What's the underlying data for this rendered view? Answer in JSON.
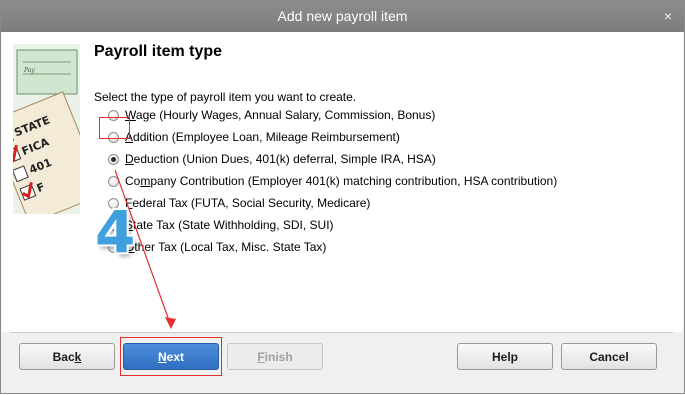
{
  "window": {
    "title": "Add new payroll item",
    "close_glyph": "×"
  },
  "heading": "Payroll item type",
  "prompt": "Select the type of payroll item you want to create.",
  "options": [
    {
      "mnemonic": "W",
      "rest": "age (Hourly Wages, Annual Salary, Commission, Bonus)",
      "checked": false
    },
    {
      "mnemonic": "A",
      "rest": "ddition (Employee Loan, Mileage Reimbursement)",
      "checked": false
    },
    {
      "mnemonic": "D",
      "rest": "eduction (Union Dues, 401(k) deferral, Simple IRA, HSA)",
      "checked": true
    },
    {
      "pre": "Co",
      "mnemonic": "m",
      "rest": "pany Contribution (Employer 401(k) matching contribution, HSA contribution)",
      "checked": false
    },
    {
      "mnemonic": "F",
      "rest": "ederal Tax (FUTA, Social Security, Medicare)",
      "checked": false
    },
    {
      "mnemonic": "S",
      "rest": "tate Tax (State Withholding, SDI, SUI)",
      "checked": false
    },
    {
      "mnemonic": "O",
      "rest": "ther Tax (Local Tax, Misc. State Tax)",
      "checked": false
    }
  ],
  "annotation": {
    "step_number": "4",
    "color": "#e53030",
    "step_color": "#3fa0dd"
  },
  "sidebar_art": {
    "labels": [
      "STATE",
      "FICA",
      "401",
      "F"
    ],
    "pay_label": "Pay"
  },
  "buttons": {
    "back": {
      "pre": "Bac",
      "mnemonic": "k",
      "rest": ""
    },
    "next": {
      "pre": "",
      "mnemonic": "N",
      "rest": "ext"
    },
    "finish": {
      "pre": "",
      "mnemonic": "F",
      "rest": "inish",
      "disabled": true
    },
    "help": {
      "label": "Help"
    },
    "cancel": {
      "label": "Cancel"
    }
  }
}
